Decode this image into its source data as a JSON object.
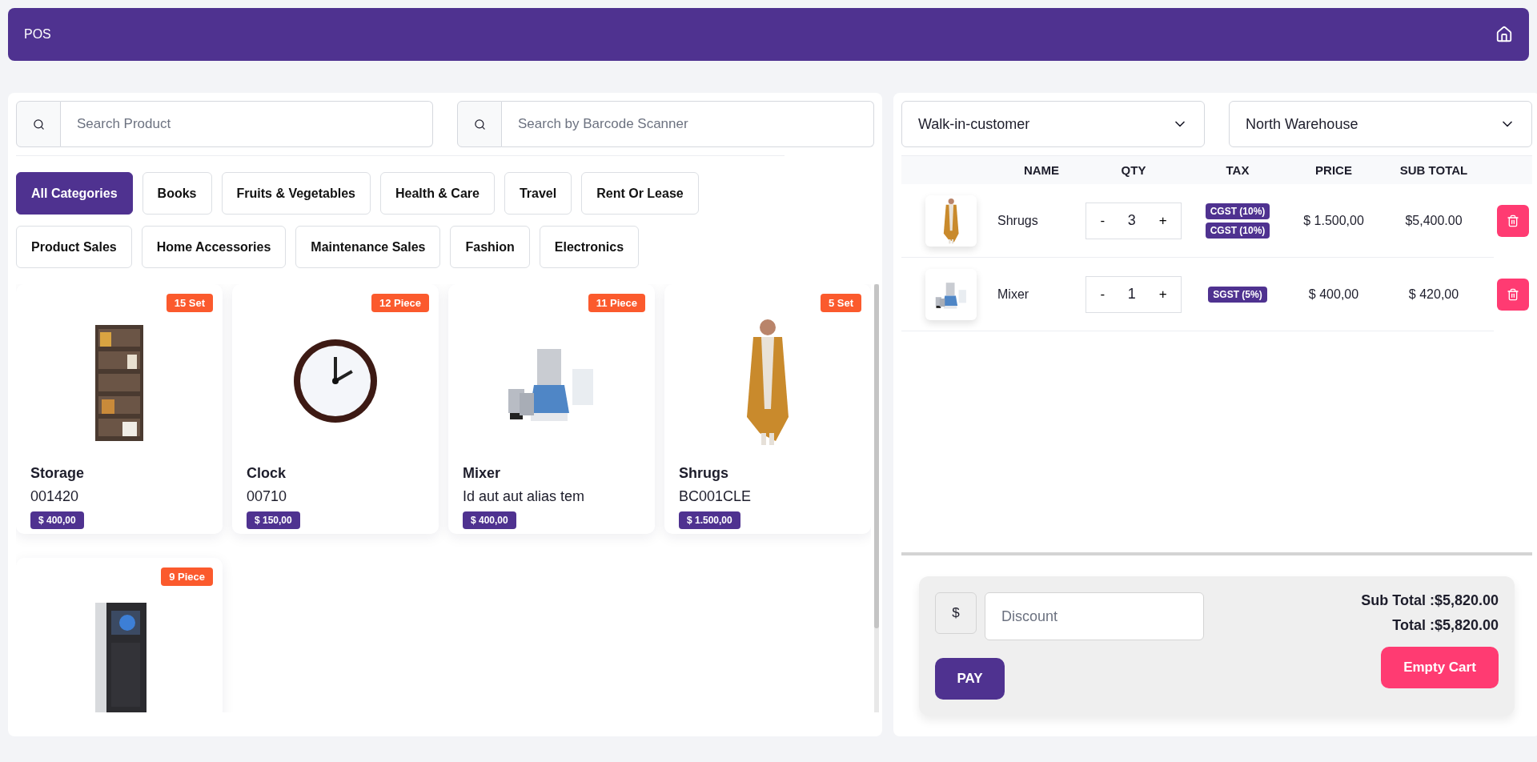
{
  "header": {
    "title": "POS"
  },
  "search": {
    "product_placeholder": "Search Product",
    "barcode_placeholder": "Search by Barcode Scanner"
  },
  "categories": [
    {
      "label": "All Categories",
      "selected": true
    },
    {
      "label": "Books",
      "selected": false
    },
    {
      "label": "Fruits & Vegetables",
      "selected": false
    },
    {
      "label": "Health & Care",
      "selected": false
    },
    {
      "label": "Travel",
      "selected": false
    },
    {
      "label": "Rent Or Lease",
      "selected": false
    },
    {
      "label": "Product Sales",
      "selected": false
    },
    {
      "label": "Home Accessories",
      "selected": false
    },
    {
      "label": "Maintenance Sales",
      "selected": false
    },
    {
      "label": "Fashion",
      "selected": false
    },
    {
      "label": "Electronics",
      "selected": false
    }
  ],
  "products": [
    {
      "kind": "shelf",
      "badge": "15 Set",
      "name": "Storage",
      "code": "001420",
      "price": "$ 400,00"
    },
    {
      "kind": "clock",
      "badge": "12 Piece",
      "name": "Clock",
      "code": "00710",
      "price": "$ 150,00"
    },
    {
      "kind": "mixer",
      "badge": "11 Piece",
      "name": "Mixer",
      "code": "Id aut aut alias tem",
      "price": "$ 400,00"
    },
    {
      "kind": "dress",
      "badge": "5 Set",
      "name": "Shrugs",
      "code": "BC001CLE",
      "price": "$ 1.500,00"
    },
    {
      "kind": "fridge",
      "badge": "9 Piece"
    }
  ],
  "customer": {
    "value": "Walk-in-customer"
  },
  "warehouse": {
    "value": "North Warehouse"
  },
  "cart": {
    "columns": [
      "NAME",
      "QTY",
      "TAX",
      "PRICE",
      "SUB TOTAL"
    ],
    "rows": [
      {
        "kind": "dress",
        "name": "Shrugs",
        "minus": "-",
        "qty": "3",
        "plus": "+",
        "taxes": [
          "CGST (10%)",
          "CGST (10%)"
        ],
        "price": "$ 1.500,00",
        "subtotal": "$5,400.00"
      },
      {
        "kind": "mixer",
        "name": "Mixer",
        "minus": "-",
        "qty": "1",
        "plus": "+",
        "taxes": [
          "SGST (5%)"
        ],
        "price": "$ 400,00",
        "subtotal": "$ 420,00"
      }
    ]
  },
  "summary": {
    "currency": "$",
    "discount_placeholder": "Discount",
    "sub_total": "Sub Total :$5,820.00",
    "total": "Total :$5,820.00",
    "pay": "PAY",
    "empty": "Empty Cart"
  }
}
